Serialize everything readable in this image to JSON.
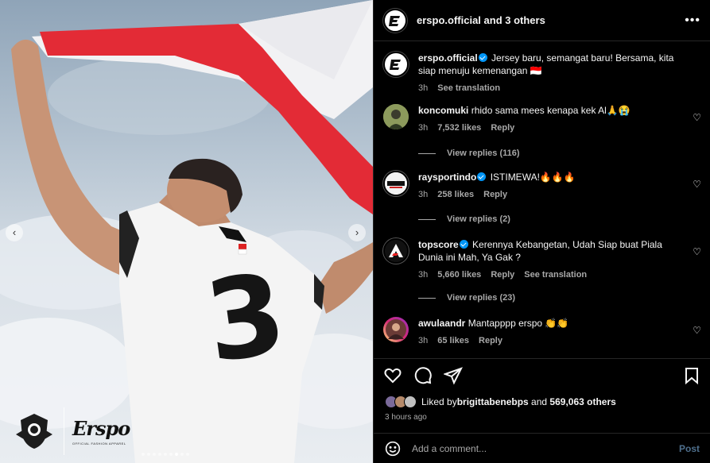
{
  "post": {
    "header_user": "erspo.official",
    "header_suffix": " and 3 others",
    "more_icon": "more-horizontal-icon"
  },
  "media": {
    "jersey_number": "3",
    "brand_text": "Erspo",
    "brand_subtext": "OFFICIAL FASHION APPAREL",
    "slides_total": 9,
    "slide_active": 7,
    "colors": {
      "flag_red": "#e32b36",
      "flag_white": "#f2f2f4",
      "sky": "#c3ced9"
    }
  },
  "comments": [
    {
      "user": "erspo.official",
      "verified": true,
      "text": "Jersey baru, semangat baru! Bersama, kita siap menuju kemenangan 🇮🇩",
      "time": "3h",
      "likes": "",
      "reply": "",
      "translate": "See translation",
      "replies": ""
    },
    {
      "user": "koncomuki",
      "verified": false,
      "text": "rhido sama mees kenapa kek Al🙏😭",
      "time": "3h",
      "likes": "7,532 likes",
      "reply": "Reply",
      "translate": "",
      "replies": "View replies (116)"
    },
    {
      "user": "raysportindo",
      "verified": true,
      "text": "ISTIMEWA!🔥🔥🔥",
      "time": "3h",
      "likes": "258 likes",
      "reply": "Reply",
      "translate": "",
      "replies": "View replies (2)"
    },
    {
      "user": "topscore",
      "verified": true,
      "text": "Kerennya Kebangetan, Udah Siap buat Piala Dunia ini Mah, Ya Gak ?",
      "time": "3h",
      "likes": "5,660 likes",
      "reply": "Reply",
      "translate": "See translation",
      "replies": "View replies (23)"
    },
    {
      "user": "awulaandr",
      "verified": false,
      "text": "Mantapppp erspo 👏👏",
      "time": "3h",
      "likes": "65 likes",
      "reply": "Reply",
      "translate": "",
      "replies": ""
    }
  ],
  "likes": {
    "prefix": "Liked by ",
    "user": "brigittabenebps",
    "middle": " and ",
    "others": "569,063 others"
  },
  "time_ago": "3 hours ago",
  "add_comment": {
    "placeholder": "Add a comment...",
    "post_label": "Post"
  }
}
